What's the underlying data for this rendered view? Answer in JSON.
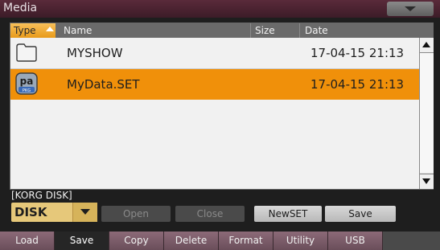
{
  "window": {
    "title": "Media"
  },
  "table": {
    "columns": {
      "type": "Type",
      "name": "Name",
      "size": "Size",
      "date": "Date"
    },
    "rows": [
      {
        "icon": "folder-icon",
        "name": "MYSHOW",
        "size": "",
        "date": "17-04-15 21:13",
        "selected": false
      },
      {
        "icon": "pa-set-icon",
        "name": "MyData.SET",
        "size": "",
        "date": "17-04-15 21:13",
        "selected": true,
        "icon_text": "pa",
        "icon_subtext": "PKG"
      }
    ]
  },
  "path": "[KORG DISK]",
  "device": {
    "selected": "DISK"
  },
  "buttons": {
    "open": "Open",
    "close": "Close",
    "newset": "NewSET",
    "save": "Save"
  },
  "tabs": [
    {
      "label": "Load",
      "active": false
    },
    {
      "label": "Save",
      "active": true
    },
    {
      "label": "Copy",
      "active": false
    },
    {
      "label": "Delete",
      "active": false
    },
    {
      "label": "Format",
      "active": false
    },
    {
      "label": "Utility",
      "active": false
    },
    {
      "label": "USB",
      "active": false
    }
  ],
  "colors": {
    "selection": "#f0900a",
    "tab": "#7a5a68",
    "active_tab": "#262626",
    "header": "#6a6a6a"
  }
}
